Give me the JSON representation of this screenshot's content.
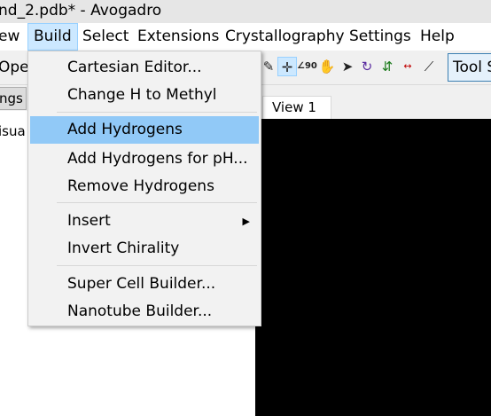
{
  "window": {
    "title": "nd_2.pdb* - Avogadro"
  },
  "menubar": {
    "items": [
      "ew",
      "Build",
      "Select",
      "Extensions",
      "Crystallography",
      "Settings",
      "Help"
    ]
  },
  "toolbar": {
    "open_label": "Ope",
    "tool_settings_label": "Tool S",
    "icons": [
      "draw-pencil-icon",
      "navigate-crosshair-icon",
      "measure-angle-icon",
      "manipulate-hand-icon",
      "select-arrow-icon",
      "rotate-icon",
      "autoopt-icon",
      "bond-length-icon",
      "align-icon"
    ]
  },
  "left_panel": {
    "tab_label": "ngs",
    "visual_label": "isua"
  },
  "view": {
    "tab_label": "View 1",
    "background": "#000000"
  },
  "build_menu": {
    "items": [
      {
        "label": "Cartesian Editor..."
      },
      {
        "label": "Change H to Methyl"
      },
      {
        "label": "Add Hydrogens",
        "highlighted": true
      },
      {
        "label": "Add Hydrogens for pH..."
      },
      {
        "label": "Remove Hydrogens"
      },
      {
        "label": "Insert",
        "submenu": true
      },
      {
        "label": "Invert Chirality"
      },
      {
        "label": "Super Cell Builder..."
      },
      {
        "label": "Nanotube Builder..."
      }
    ]
  },
  "colors": {
    "highlight": "#91c9f7",
    "menu_active": "#cce8ff"
  }
}
